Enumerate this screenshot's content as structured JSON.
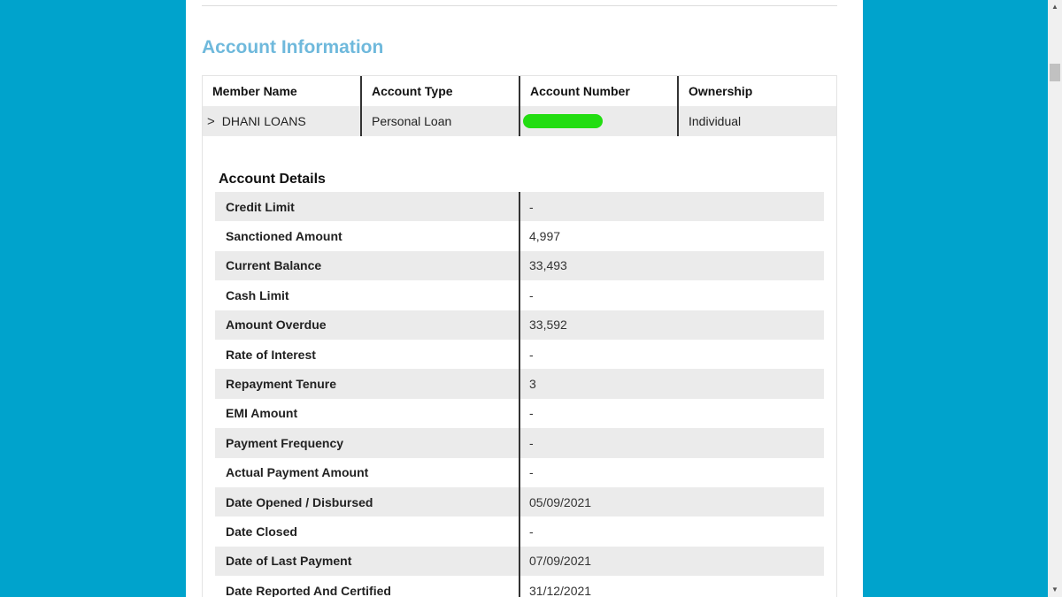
{
  "account_info": {
    "title": "Account Information",
    "headers": [
      "Member Name",
      "Account Type",
      "Account Number",
      "Ownership"
    ],
    "row": {
      "member_name": "DHANI LOANS",
      "account_type": "Personal Loan",
      "account_number_redacted": true,
      "ownership": "Individual"
    }
  },
  "account_details": {
    "title": "Account Details",
    "rows": [
      {
        "label": "Credit Limit",
        "value": "-"
      },
      {
        "label": "Sanctioned Amount",
        "value": "4,997"
      },
      {
        "label": "Current Balance",
        "value": "33,493"
      },
      {
        "label": "Cash Limit",
        "value": "-"
      },
      {
        "label": "Amount Overdue",
        "value": "33,592"
      },
      {
        "label": "Rate of Interest",
        "value": "-"
      },
      {
        "label": "Repayment Tenure",
        "value": "3"
      },
      {
        "label": "EMI Amount",
        "value": "-"
      },
      {
        "label": "Payment Frequency",
        "value": "-"
      },
      {
        "label": "Actual Payment Amount",
        "value": "-"
      },
      {
        "label": "Date Opened / Disbursed",
        "value": "05/09/2021"
      },
      {
        "label": "Date Closed",
        "value": "-"
      },
      {
        "label": "Date of Last Payment",
        "value": "07/09/2021"
      },
      {
        "label": "Date Reported And Certified",
        "value": "31/12/2021"
      }
    ]
  },
  "colors": {
    "background": "#00a3cc",
    "title_accent": "#6fb9dc",
    "redaction": "#22dd11"
  }
}
